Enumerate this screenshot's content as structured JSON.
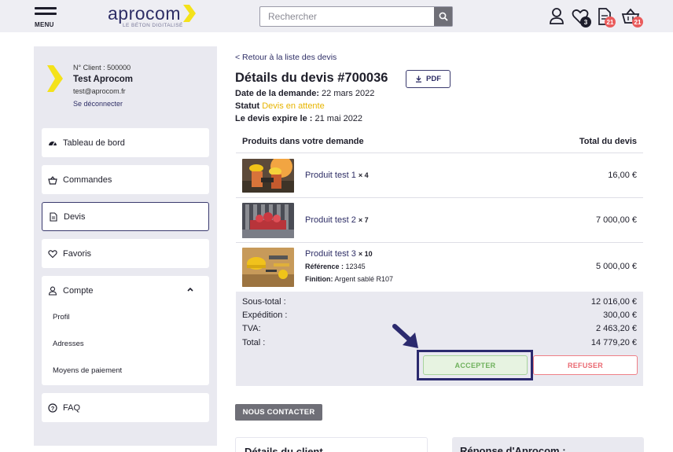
{
  "header": {
    "menu_label": "MENU",
    "logo_text": "aprocom",
    "logo_tagline": "LE BÉTON DIGITALISÉ",
    "search_placeholder": "Rechercher",
    "favorites_count": "3",
    "quotes_count": "21",
    "cart_count": "21",
    "icons": [
      "user-icon",
      "heart-icon",
      "document-icon",
      "basket-icon",
      "search-icon"
    ]
  },
  "sidebar": {
    "client_number": "N° Client : 500000",
    "client_name": "Test Aprocom",
    "client_email": "test@aprocom.fr",
    "logout": "Se déconnecter",
    "items": [
      {
        "label": "Tableau de bord",
        "icon": "dashboard-icon"
      },
      {
        "label": "Commandes",
        "icon": "basket-icon"
      },
      {
        "label": "Devis",
        "icon": "document-icon"
      },
      {
        "label": "Favoris",
        "icon": "heart-icon"
      }
    ],
    "compte": {
      "label": "Compte",
      "sub": [
        "Profil",
        "Adresses",
        "Moyens de paiement"
      ]
    },
    "faq": "FAQ"
  },
  "main": {
    "back_link": "< Retour à la liste des devis",
    "title": "Détails du devis #700036",
    "pdf_label": "PDF",
    "date_label": "Date de la demande:",
    "date_value": "22 mars 2022",
    "status_label": "Statut",
    "status_value": "Devis en attente",
    "expiry_label": "Le devis expire le :",
    "expiry_value": "21 mai 2022",
    "table": {
      "col_products": "Produits dans votre demande",
      "col_total": "Total du devis",
      "rows": [
        {
          "name": "Produit test 1",
          "qty": "× 4",
          "price": "16,00 €"
        },
        {
          "name": "Produit test 2",
          "qty": "× 7",
          "price": "7 000,00 €"
        },
        {
          "name": "Produit test 3",
          "qty": "× 10",
          "ref_label": "Référence :",
          "ref_value": "12345",
          "finish_label": "Finition:",
          "finish_value": "Argent sablé R107",
          "price": "5 000,00 €"
        }
      ]
    },
    "totals": {
      "subtotal_label": "Sous-total :",
      "subtotal": "12 016,00 €",
      "shipping_label": "Expédition :",
      "shipping": "300,00 €",
      "tva_label": "TVA:",
      "tva": "2 463,20 €",
      "total_label": "Total :",
      "total": "14 779,20 €"
    },
    "accept_label": "ACCEPTER",
    "refuse_label": "REFUSER",
    "contact_label": "NOUS CONTACTER",
    "client_card_title": "Détails du client",
    "response_card_title": "Réponse d'Aprocom :"
  },
  "colors": {
    "brand_navy": "#2e2e66",
    "status_yellow": "#e7b400",
    "accept_green": "#6fb15c",
    "refuse_red": "#ea6770",
    "logo_yellow": "#f4e21a"
  }
}
